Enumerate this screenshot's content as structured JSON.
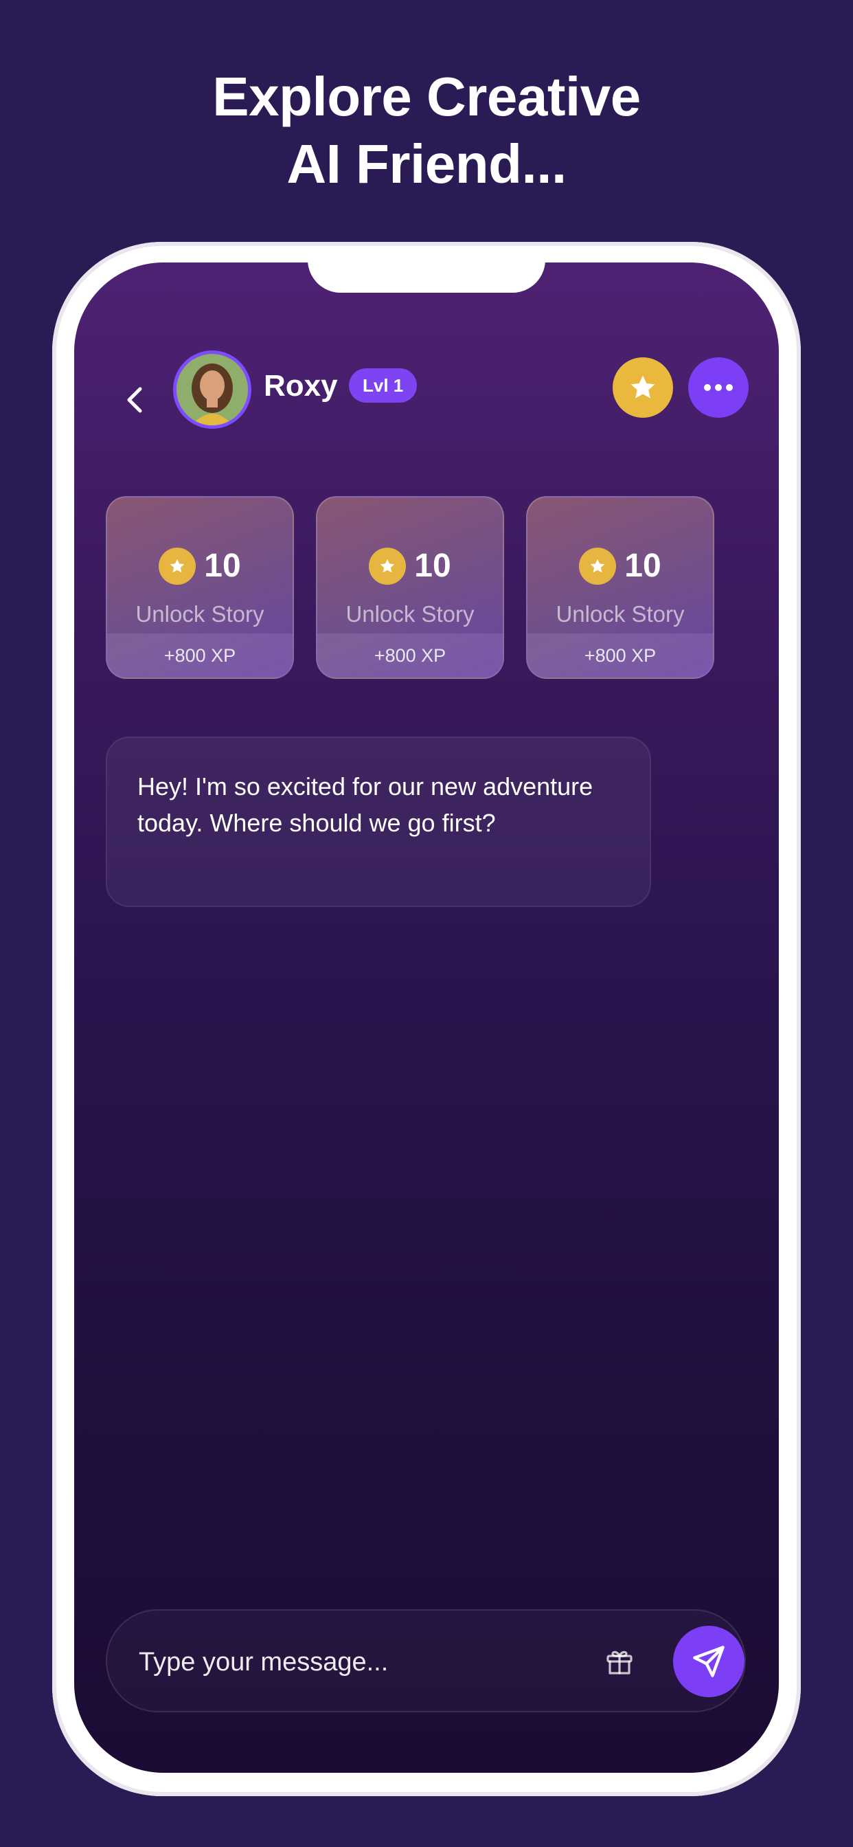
{
  "headline": {
    "line1": "Explore Creative",
    "line2": "AI Friend..."
  },
  "header": {
    "back_icon": "chevron-left-icon",
    "character_name": "Roxy",
    "level_badge": "Lvl 1",
    "star_icon": "star-icon",
    "more_icon": "more-horizontal-icon"
  },
  "cards": [
    {
      "cost": "10",
      "label": "Unlock Story",
      "xp": "+800 XP"
    },
    {
      "cost": "10",
      "label": "Unlock Story",
      "xp": "+800 XP"
    },
    {
      "cost": "10",
      "label": "Unlock Story",
      "xp": "+800 XP"
    }
  ],
  "messages": [
    {
      "text": "Hey! I'm so excited for our new adventure today. Where should we go first?"
    }
  ],
  "composer": {
    "placeholder": "Type your message...",
    "gift_icon": "gift-icon",
    "send_icon": "send-icon"
  },
  "colors": {
    "accent": "#7d3ff5",
    "gold": "#e9b83c",
    "background": "#2b1b54"
  }
}
